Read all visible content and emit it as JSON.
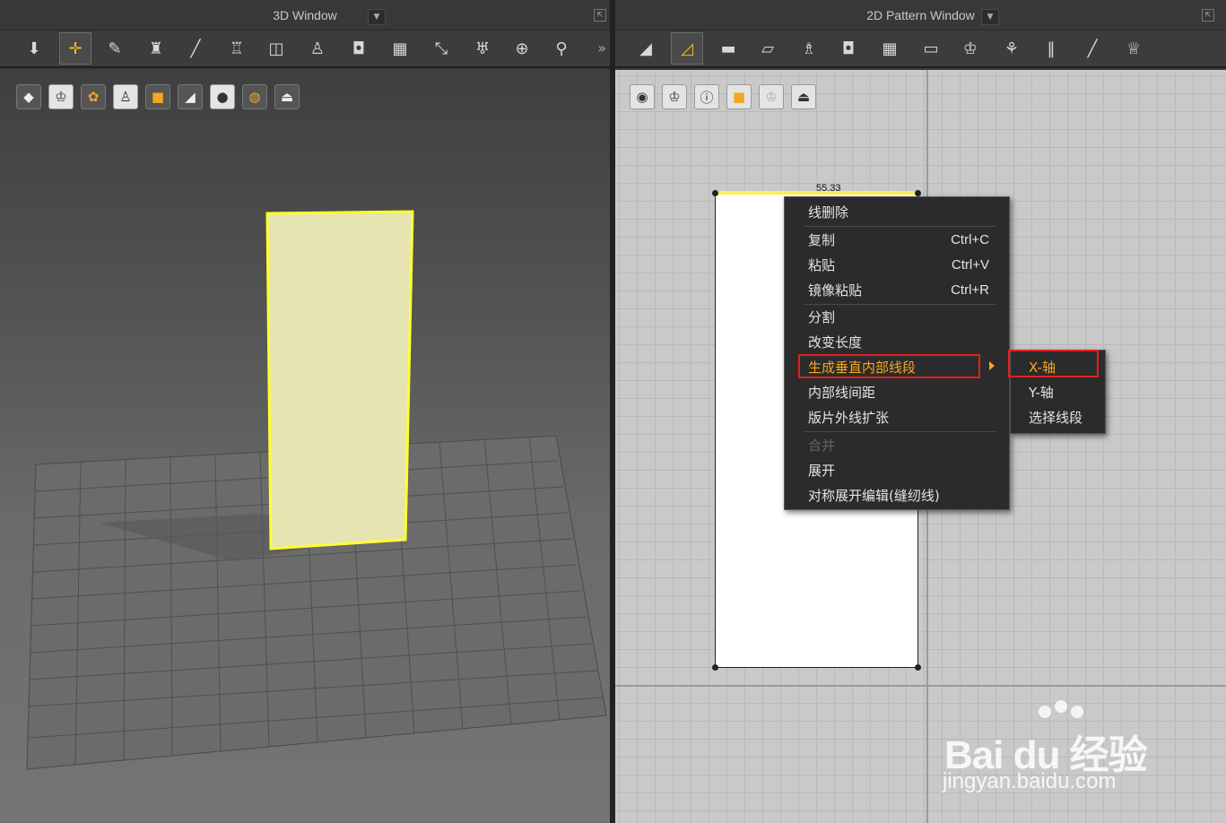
{
  "window3d": {
    "title": "3D Window",
    "toolbar": [
      "down-arrow-icon",
      "select-move-icon",
      "edit-pattern-icon",
      "garment-icon",
      "needle-icon",
      "shirt-icon",
      "fold-icon",
      "avatar-icon",
      "tack-icon",
      "grid-icon",
      "pin-icon",
      "skirt-icon",
      "button-icon",
      "zipper-icon"
    ],
    "view_tools": [
      "cube-icon",
      "shirt-icon",
      "flower-icon",
      "avatar-icon",
      "texture-icon",
      "shade-icon",
      "head-icon",
      "globe-icon",
      "tray-icon"
    ]
  },
  "window2d": {
    "title": "2D Pattern Window",
    "toolbar": [
      "transform-pattern-icon",
      "edit-point-icon",
      "rectangle-icon",
      "polygon-icon",
      "sewing-icon",
      "fold-icon",
      "grid-icon",
      "iron-icon",
      "shirt-sew-icon",
      "mesh-icon",
      "stripes-icon",
      "line-icon",
      "tshirt-icon"
    ],
    "view_tools": [
      "eye-brush-icon",
      "eye-shirt-icon",
      "info-icon",
      "texture-icon",
      "shirt-faded-icon",
      "tray-icon"
    ],
    "measure_label": "55.33"
  },
  "context_menu": {
    "items": [
      {
        "label": "线删除",
        "shortcut": ""
      },
      {
        "label": "复制",
        "shortcut": "Ctrl+C"
      },
      {
        "label": "粘贴",
        "shortcut": "Ctrl+V"
      },
      {
        "label": "镜像粘贴",
        "shortcut": "Ctrl+R"
      },
      {
        "label": "分割",
        "shortcut": ""
      },
      {
        "label": "改变长度",
        "shortcut": ""
      },
      {
        "label": "生成垂直内部线段",
        "shortcut": ""
      },
      {
        "label": "内部线间距",
        "shortcut": ""
      },
      {
        "label": "版片外线扩张",
        "shortcut": ""
      },
      {
        "label": "合并",
        "shortcut": ""
      },
      {
        "label": "展开",
        "shortcut": ""
      },
      {
        "label": "对称展开编辑(缝纫线)",
        "shortcut": ""
      }
    ],
    "submenu": [
      "X-轴",
      "Y-轴",
      "选择线段"
    ]
  },
  "watermark": {
    "brand": "Bai du 经验",
    "url": "jingyan.baidu.com"
  },
  "colors": {
    "highlight": "#f5a623",
    "redbox": "#e02020",
    "pattern_fill": "#f0eeaa",
    "pattern_edge": "#ffff33"
  }
}
